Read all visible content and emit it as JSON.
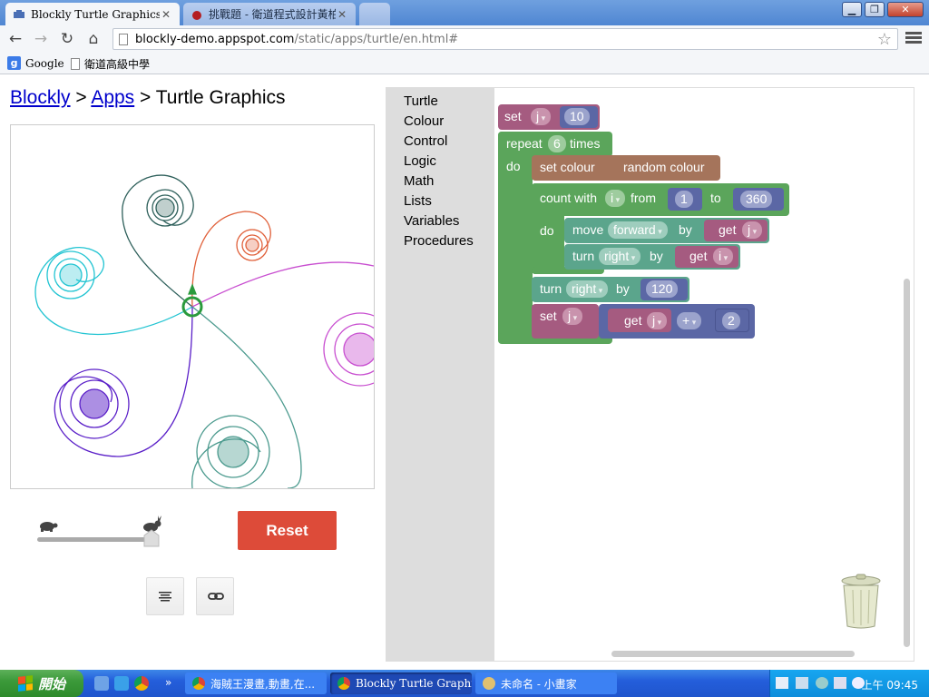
{
  "browser": {
    "tabs": [
      {
        "title": "Blockly Turtle Graphics",
        "active": true
      },
      {
        "title": "挑戰題 - 衛道程式設計黃柏",
        "active": false
      }
    ],
    "url_domain": "blockly-demo.appspot.com",
    "url_path": "/static/apps/turtle/en.html#",
    "bookmarks": [
      "Google",
      "衛道高級中學"
    ],
    "window_controls": {
      "close": "✕"
    }
  },
  "page": {
    "breadcrumb": {
      "link1": "Blockly",
      "sep1": " > ",
      "link2": "Apps",
      "sep2": " > ",
      "current": "Turtle Graphics"
    },
    "reset_label": "Reset",
    "speed_slider": {
      "value": 1.0
    }
  },
  "toolbox": {
    "categories": [
      "Turtle",
      "Colour",
      "Control",
      "Logic",
      "Math",
      "Lists",
      "Variables",
      "Procedures"
    ]
  },
  "blocks": {
    "set1": {
      "set": "set",
      "var": "j",
      "value": "10"
    },
    "repeat": {
      "repeat": "repeat",
      "count": "6",
      "times": "times",
      "do": "do"
    },
    "set_colour": {
      "label": "set colour",
      "value": "random colour"
    },
    "count": {
      "label": "count with",
      "var": "i",
      "from": "from",
      "from_val": "1",
      "to": "to",
      "to_val": "360",
      "do": "do"
    },
    "move": {
      "label": "move",
      "dir": "forward",
      "by": "by",
      "get": "get",
      "var": "j"
    },
    "turn1": {
      "label": "turn",
      "dir": "right",
      "by": "by",
      "get": "get",
      "var": "i"
    },
    "turn2": {
      "label": "turn",
      "dir": "right",
      "by": "by",
      "value": "120"
    },
    "set2": {
      "set": "set",
      "var": "j",
      "get": "get",
      "getvar": "j",
      "op": "+",
      "value": "2"
    }
  },
  "taskbar": {
    "start": "開始",
    "tasks": [
      "海賊王漫畫,動畫,在...",
      "Blockly Turtle Graphi...",
      "未命名 - 小畫家"
    ],
    "clock": "上午 09:45"
  },
  "colors": {
    "turtle_green": "#5ba55b",
    "colour_brown": "#a5745b",
    "variable_pink": "#a55b80",
    "math_blue": "#5b67a5",
    "turtle_teal": "#5ba58c",
    "reset_red": "#dd4b39"
  }
}
